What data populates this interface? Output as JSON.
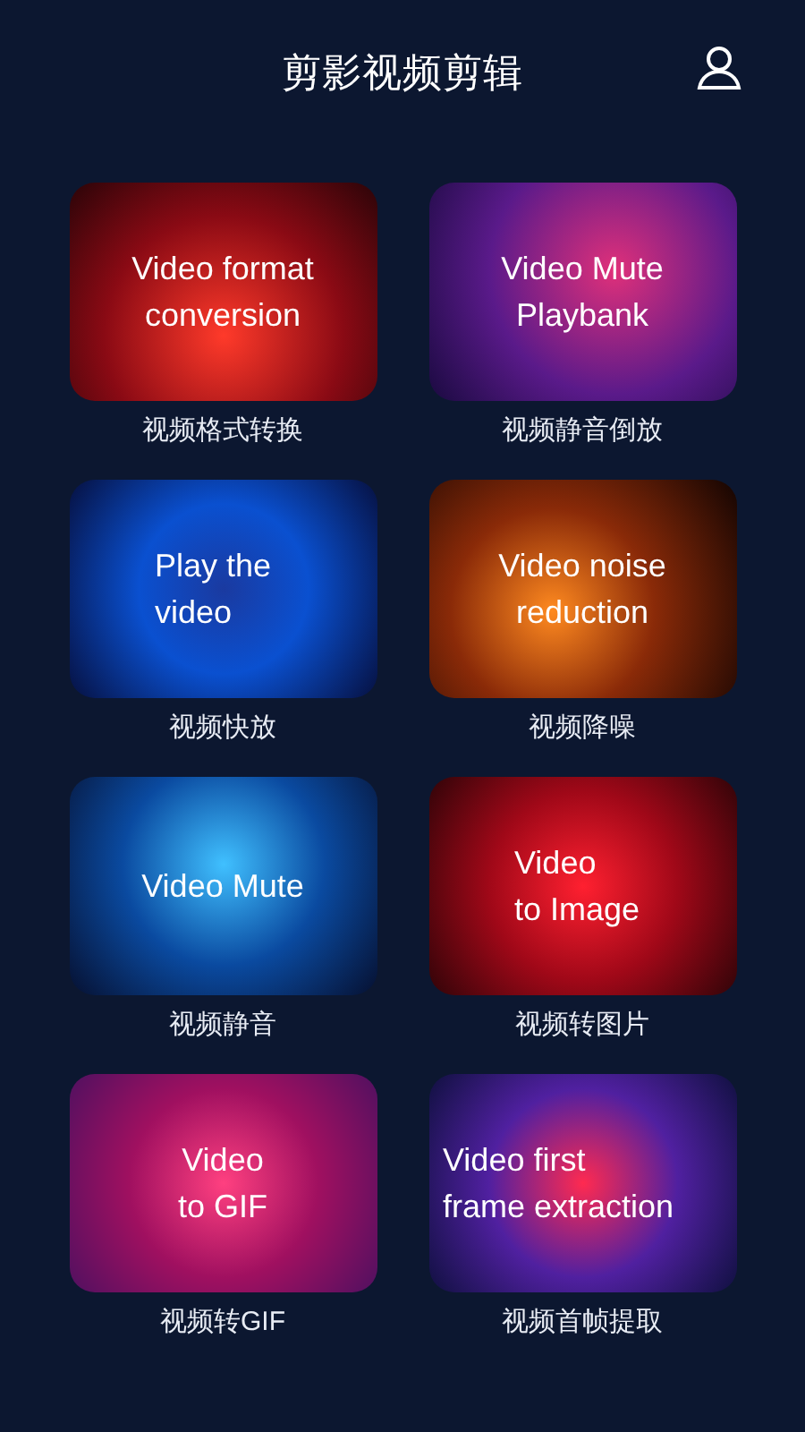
{
  "header": {
    "title": "剪影视频剪辑"
  },
  "tools": [
    {
      "card_text": "Video format\nconversion",
      "label": "视频格式转换"
    },
    {
      "card_text": "Video Mute\nPlaybank",
      "label": "视频静音倒放"
    },
    {
      "card_text": "Play the\nvideo",
      "label": "视频快放"
    },
    {
      "card_text": "Video noise\nreduction",
      "label": "视频降噪"
    },
    {
      "card_text": "Video Mute",
      "label": "视频静音"
    },
    {
      "card_text": "Video\nto Image",
      "label": "视频转图片"
    },
    {
      "card_text": "Video\nto GIF",
      "label": "视频转GIF"
    },
    {
      "card_text": "Video first\nframe extraction",
      "label": "视频首帧提取"
    }
  ]
}
